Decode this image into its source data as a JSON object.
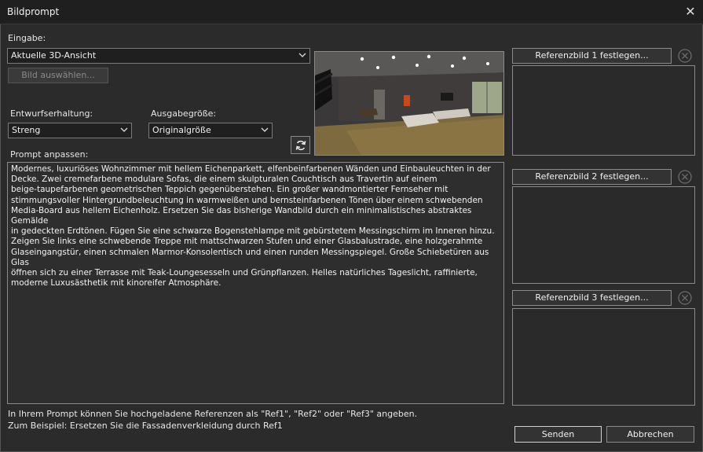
{
  "window": {
    "title": "Bildprompt",
    "close_icon": "close-icon"
  },
  "input": {
    "label": "Eingabe:",
    "source_value": "Aktuelle 3D-Ansicht",
    "select_image_label": "Bild auswählen..."
  },
  "design": {
    "label": "Entwurfserhaltung:",
    "value": "Streng"
  },
  "output": {
    "label": "Ausgabegröße:",
    "value": "Originalgröße"
  },
  "prompt": {
    "label": "Prompt anpassen:",
    "text": "Modernes, luxuriöses Wohnzimmer mit hellem Eichenparkett, elfenbeinfarbenen Wänden und Einbauleuchten in der\nDecke. Zwei cremefarbene modulare Sofas, die einem skulpturalen Couchtisch aus Travertin auf einem\nbeige-taupefarbenen geometrischen Teppich gegenüberstehen. Ein großer wandmontierter Fernseher mit\nstimmungsvoller Hintergrundbeleuchtung in warmweißen und bernsteinfarbenen Tönen über einem schwebenden\nMedia-Board aus hellem Eichenholz. Ersetzen Sie das bisherige Wandbild durch ein minimalistisches abstraktes Gemälde\nin gedeckten Erdtönen. Fügen Sie eine schwarze Bogenstehlampe mit gebürstetem Messingschirm im Inneren hinzu.\nZeigen Sie links eine schwebende Treppe mit mattschwarzen Stufen und einer Glasbalustrade, eine holzgerahmte\nGlaseingangstür, einen schmalen Marmor-Konsolentisch und einen runden Messingspiegel. Große Schiebetüren aus Glas\nöffnen sich zu einer Terrasse mit Teak-Loungesesseln und Grünpflanzen. Helles natürliches Tageslicht, raffinierte,\nmoderne Luxusästhetik mit kinoreifer Atmosphäre."
  },
  "references": [
    {
      "label": "Referenzbild 1 festlegen..."
    },
    {
      "label": "Referenzbild 2 festlegen..."
    },
    {
      "label": "Referenzbild 3 festlegen..."
    }
  ],
  "footer": {
    "hint_line1": "In Ihrem Prompt können Sie hochgeladene Referenzen als \"Ref1\", \"Ref2\" oder \"Ref3\" angeben.",
    "hint_line2": "Zum Beispiel: Ersetzen Sie die Fassadenverkleidung durch Ref1",
    "send_label": "Senden",
    "cancel_label": "Abbrechen"
  },
  "colors": {
    "background": "#2b2b2b",
    "titlebar": "#1f1f1f",
    "field_bg": "#1f1f1f",
    "border": "#8a8a8a"
  }
}
